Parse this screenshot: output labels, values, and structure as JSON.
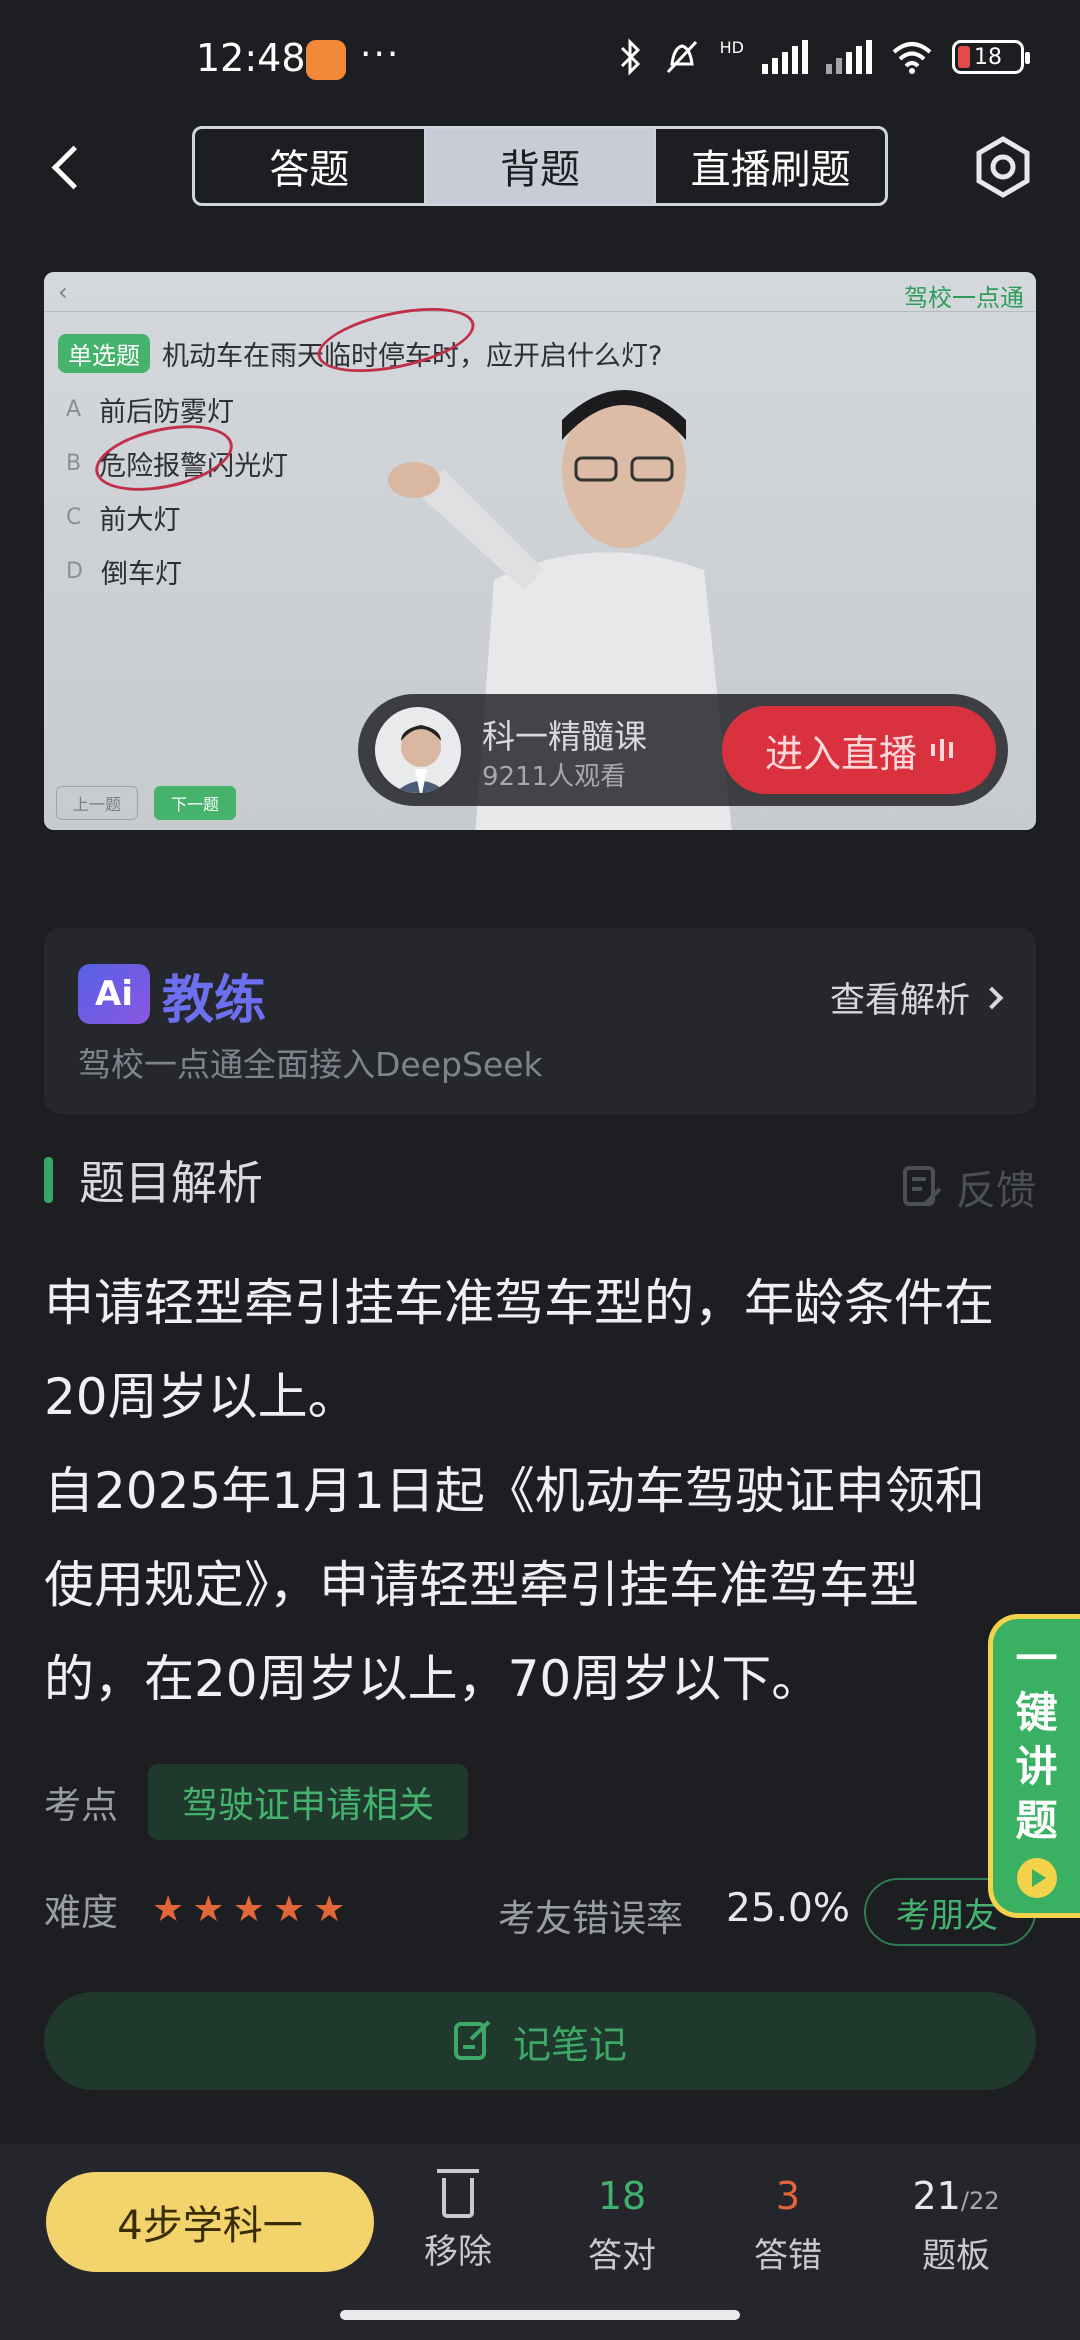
{
  "status": {
    "time": "12:48",
    "dots": "···",
    "battery": "18",
    "network": "HD"
  },
  "nav": {
    "tabs": [
      "答题",
      "背题",
      "直播刷题"
    ],
    "active_tab": "背题"
  },
  "video": {
    "slide": {
      "back": "‹",
      "logo": "驾校一点通",
      "question_type": "单选题",
      "question": "机动车在雨天临时停车时，应开启什么灯?",
      "options": [
        {
          "letter": "A",
          "text": "前后防雾灯"
        },
        {
          "letter": "B",
          "text": "危险报警闪光灯"
        },
        {
          "letter": "C",
          "text": "前大灯"
        },
        {
          "letter": "D",
          "text": "倒车灯"
        }
      ],
      "prev": "上一题",
      "next": "下一题"
    },
    "live": {
      "title": "科一精髓课",
      "viewers": "9211人观看",
      "button": "进入直播"
    }
  },
  "ai": {
    "logo": "Ai",
    "title": "教练",
    "subtitle": "驾校一点通全面接入DeepSeek",
    "link": "查看解析"
  },
  "analysis": {
    "section_title": "题目解析",
    "feedback": "反馈",
    "p1": "申请轻型牵引挂车准驾车型的，年龄条件在20周岁以上。",
    "p2": "自2025年1月1日起《机动车驾驶证申领和使用规定》，申请轻型牵引挂车准驾车型的，在20周岁以上，70周岁以下。"
  },
  "meta": {
    "kp_label": "考点",
    "kp_tag": "驾驶证申请相关",
    "diff_label": "难度",
    "difficulty_stars": 5,
    "error_label": "考友错误率",
    "error_rate": "25.0%",
    "friend_button": "考朋友"
  },
  "note_button": "记笔记",
  "float_button": [
    "一",
    "键",
    "讲",
    "题"
  ],
  "bottom": {
    "learn": "4步学科一",
    "remove": "移除",
    "correct_count": "18",
    "correct_label": "答对",
    "wrong_count": "3",
    "wrong_label": "答错",
    "board_current": "21",
    "board_total": "/22",
    "board_label": "题板"
  },
  "colors": {
    "accent_green": "#3ab062",
    "correct": "#3fb270",
    "wrong": "#e2663a",
    "live_red": "#d9323e",
    "learn_yellow": "#f3d36c"
  }
}
